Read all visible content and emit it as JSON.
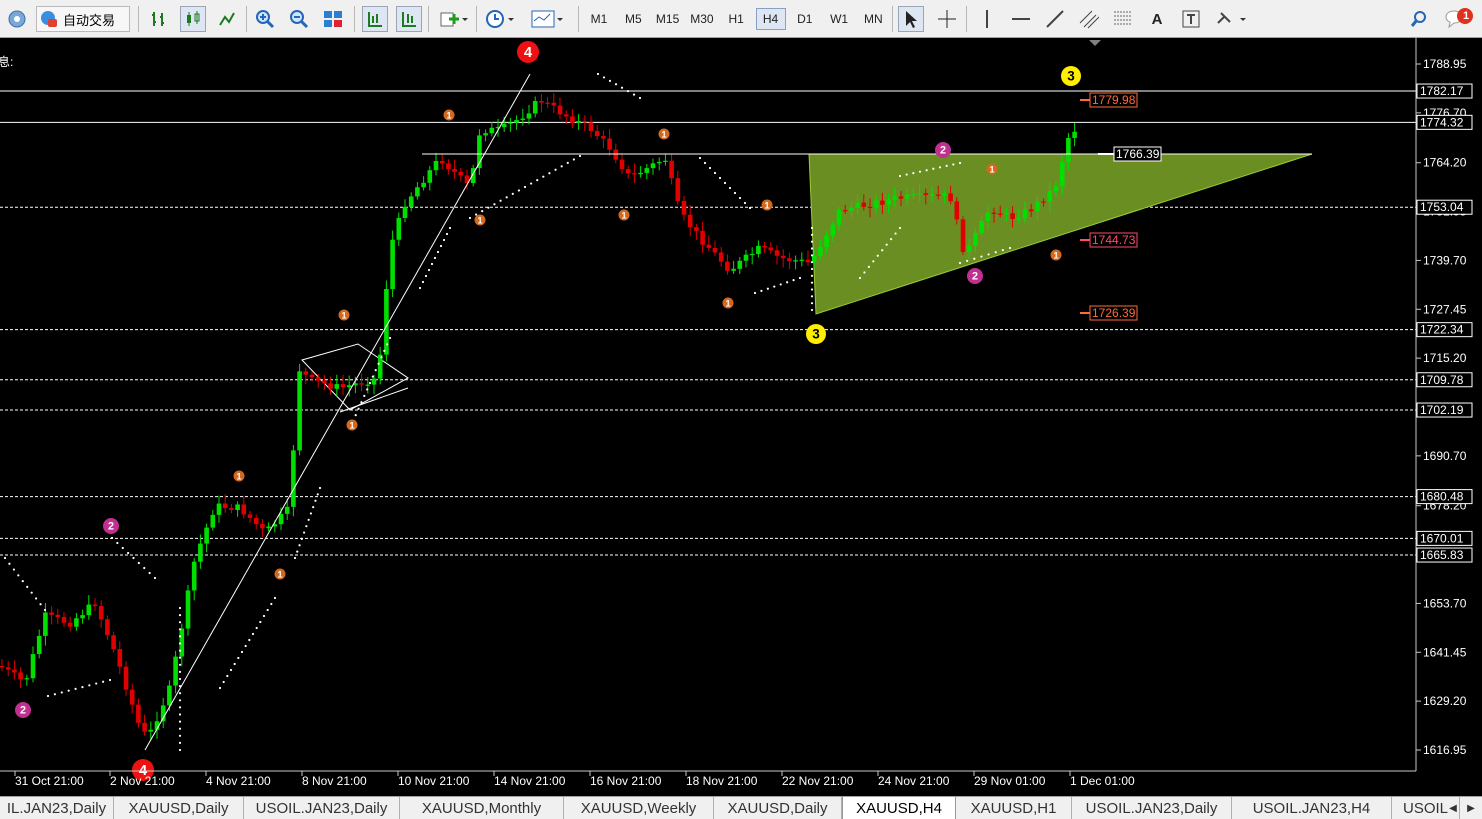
{
  "toolbar": {
    "auto_trading_label": "自动交易",
    "timeframes": [
      "M1",
      "M5",
      "M15",
      "M30",
      "H1",
      "H4",
      "D1",
      "W1",
      "MN"
    ],
    "active_timeframe": "H4",
    "notification_count": "1"
  },
  "chart": {
    "info_label": "息:",
    "price_axis": [
      "1788.95",
      "1776.70",
      "1764.20",
      "1751.95",
      "1739.70",
      "1727.45",
      "1715.20",
      "1702.95",
      "1690.70",
      "1678.20",
      "1665.95",
      "1653.70",
      "1641.45",
      "1629.20",
      "1616.95"
    ],
    "time_axis": [
      "31 Oct 21:00",
      "2 Nov 21:00",
      "4 Nov 21:00",
      "8 Nov 21:00",
      "10 Nov 21:00",
      "14 Nov 21:00",
      "16 Nov 21:00",
      "18 Nov 21:00",
      "22 Nov 21:00",
      "24 Nov 21:00",
      "29 Nov 01:00",
      "1 Dec 01:00"
    ],
    "level_tags": [
      "1782.17",
      "1774.32",
      "1753.04",
      "1722.34",
      "1709.78",
      "1702.19",
      "1680.48",
      "1670.01",
      "1665.83"
    ],
    "price_labels": [
      "1779.98",
      "1766.39",
      "1744.73",
      "1726.39"
    ],
    "wave_markers": [
      "4",
      "3",
      "3",
      "4",
      "2",
      "2",
      "2",
      "2"
    ],
    "wave_labels": "1"
  },
  "tabs": [
    "IL.JAN23,Daily",
    "XAUUSD,Daily",
    "USOIL.JAN23,Daily",
    "XAUUSD,Monthly",
    "XAUUSD,Weekly",
    "XAUUSD,Daily",
    "XAUUSD,H4",
    "XAUUSD,H1",
    "USOIL.JAN23,Daily",
    "USOIL.JAN23,H4",
    "USOIL"
  ],
  "active_tab": "XAUUSD,H4",
  "colors": {
    "bull": "#00e000",
    "bear": "#e00000",
    "triangle_fill": "#6b8e23",
    "wave4": "#ee1111",
    "wave3": "#ffee00",
    "wave2": "#c0308f",
    "wave1": "#d2691e"
  }
}
